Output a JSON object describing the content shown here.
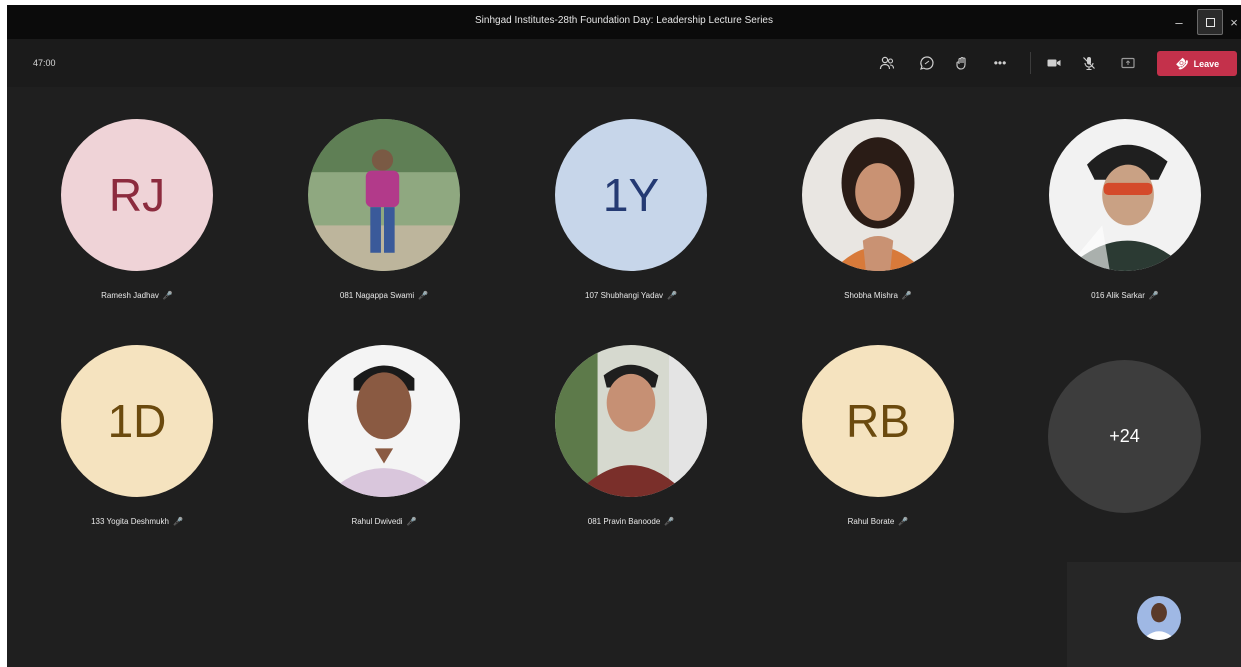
{
  "window": {
    "title": "Sinhgad Institutes-28th Foundation Day: Leadership Lecture Series",
    "minimize_glyph": "–",
    "close_glyph": "×"
  },
  "toolbar": {
    "timer": "47:00",
    "icons": [
      "participants-icon",
      "chat-icon",
      "raise-hand-icon",
      "more-actions-icon",
      "camera-icon",
      "mic-icon",
      "share-screen-icon"
    ],
    "more_glyph": "•••",
    "leave_label": "Leave"
  },
  "participants": [
    {
      "name": "Ramesh Jadhav",
      "initials": "RJ",
      "avatar_bg": "#efd3d7",
      "avatar_fg": "#8c2b3e",
      "has_photo": false
    },
    {
      "name": "081 Nagappa Swami",
      "initials": "",
      "has_photo": true
    },
    {
      "name": "107 Shubhangi Yadav",
      "initials": "1Y",
      "avatar_bg": "#c7d6ea",
      "avatar_fg": "#243a73",
      "has_photo": false
    },
    {
      "name": "Shobha Mishra",
      "initials": "",
      "has_photo": true
    },
    {
      "name": "016 Alik Sarkar",
      "initials": "",
      "has_photo": true
    },
    {
      "name": "133 Yogita Deshmukh",
      "initials": "1D",
      "avatar_bg": "#f5e3bf",
      "avatar_fg": "#6b4a0e",
      "has_photo": false
    },
    {
      "name": "Rahul Dwivedi",
      "initials": "",
      "has_photo": true
    },
    {
      "name": "081 Pravin Banoode",
      "initials": "",
      "has_photo": true
    },
    {
      "name": "Rahul Borate",
      "initials": "RB",
      "avatar_bg": "#f5e3bf",
      "avatar_fg": "#6b4a0e",
      "has_photo": false
    }
  ],
  "overflow": {
    "label": "+24"
  },
  "mic_glyph": "🎙",
  "colors": {
    "stage_bg": "#1f1f1f",
    "titlebar_bg": "#0b0b0b",
    "leave_red": "#c4314b"
  }
}
